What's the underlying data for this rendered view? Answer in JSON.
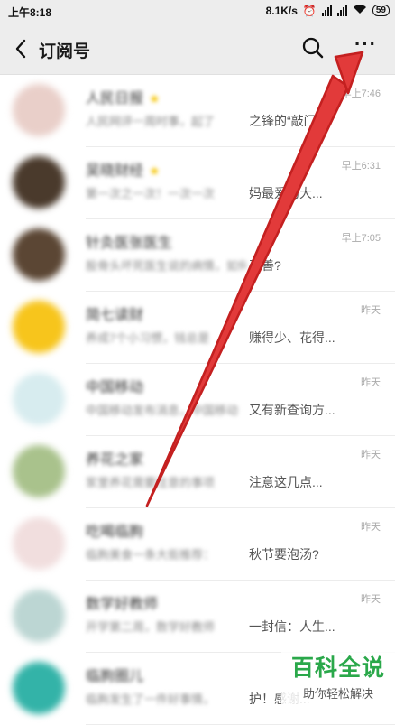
{
  "status_bar": {
    "time": "上午8:18",
    "network_speed": "8.1K/s",
    "battery": "59"
  },
  "nav": {
    "title": "订阅号",
    "back_icon": "back-chevron-icon",
    "search_icon": "search-icon",
    "more_label": "···"
  },
  "items": [
    {
      "name": "人民日报",
      "starred": true,
      "snippet_blur": "人民网评一周时事，起了",
      "snippet_clear": "之锋的“敲门",
      "time": "早上7:46",
      "avatar_color": "#e9cfc9"
    },
    {
      "name": "吴晓财经",
      "starred": true,
      "snippet_blur": "第一次之一次！一次一次",
      "snippet_clear": "妈最爱的大...",
      "time": "早上6:31",
      "avatar_color": "#4a3a2c"
    },
    {
      "name": "针灸医张医生",
      "starred": false,
      "snippet_blur": "股骨头坏死医生说的病情，如何",
      "snippet_clear": "改善?",
      "time": "早上7:05",
      "avatar_color": "#5b4634"
    },
    {
      "name": "简七读财",
      "starred": false,
      "snippet_blur": "养成7个小习惯，钱总是",
      "snippet_clear": "赚得少、花得...",
      "time": "昨天",
      "avatar_color": "#f7c51c"
    },
    {
      "name": "中国移动",
      "starred": false,
      "snippet_blur": "中国移动发布消息，中国移动",
      "snippet_clear": "又有新查询方...",
      "time": "昨天",
      "avatar_color": "#d7ecef"
    },
    {
      "name": "养花之家",
      "starred": false,
      "snippet_blur": "家里养花需要注意的事项",
      "snippet_clear": "注意这几点...",
      "time": "昨天",
      "avatar_color": "#a9c28c"
    },
    {
      "name": "吃喝临朐",
      "starred": false,
      "snippet_blur": "临朐美食一条大街推荐：",
      "snippet_clear": "秋节要泡汤?",
      "time": "昨天",
      "avatar_color": "#f1dede"
    },
    {
      "name": "数学好教师",
      "starred": false,
      "snippet_blur": "开学第二周，数学好教师",
      "snippet_clear": "一封信：人生...",
      "time": "昨天",
      "avatar_color": "#bcd6d3"
    },
    {
      "name": "临朐圈儿",
      "starred": false,
      "snippet_blur": "临朐发生了一件好事情，",
      "snippet_clear": "护！感谢...",
      "time": "",
      "avatar_color": "#33b3a8"
    }
  ],
  "watermark": {
    "title": "百科全说",
    "subtitle": "助你轻松解决"
  },
  "colors": {
    "header_bg": "#ededed",
    "annotation_arrow": "#d42b2b",
    "watermark_green": "#2aa84a",
    "star": "#f5c400"
  }
}
